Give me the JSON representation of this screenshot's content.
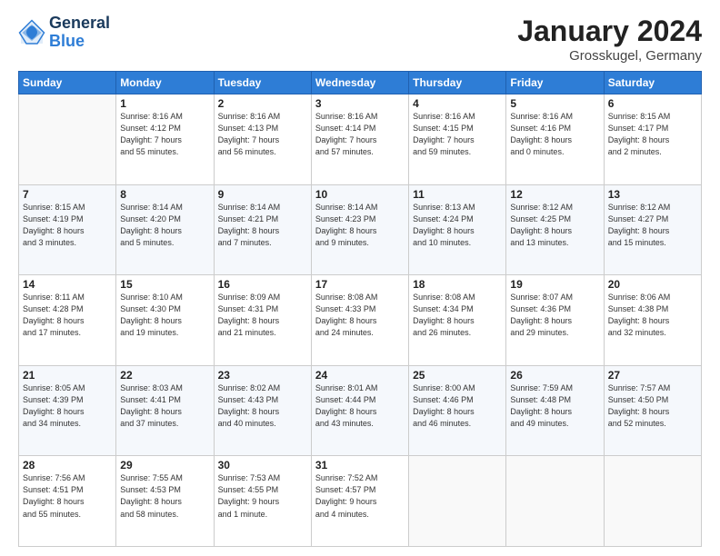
{
  "header": {
    "logo": {
      "line1": "General",
      "line2": "Blue"
    },
    "title": "January 2024",
    "subtitle": "Grosskugel, Germany"
  },
  "days_of_week": [
    "Sunday",
    "Monday",
    "Tuesday",
    "Wednesday",
    "Thursday",
    "Friday",
    "Saturday"
  ],
  "weeks": [
    [
      {
        "num": "",
        "sunrise": "",
        "sunset": "",
        "daylight": ""
      },
      {
        "num": "1",
        "sunrise": "Sunrise: 8:16 AM",
        "sunset": "Sunset: 4:12 PM",
        "daylight": "Daylight: 7 hours and 55 minutes."
      },
      {
        "num": "2",
        "sunrise": "Sunrise: 8:16 AM",
        "sunset": "Sunset: 4:13 PM",
        "daylight": "Daylight: 7 hours and 56 minutes."
      },
      {
        "num": "3",
        "sunrise": "Sunrise: 8:16 AM",
        "sunset": "Sunset: 4:14 PM",
        "daylight": "Daylight: 7 hours and 57 minutes."
      },
      {
        "num": "4",
        "sunrise": "Sunrise: 8:16 AM",
        "sunset": "Sunset: 4:15 PM",
        "daylight": "Daylight: 7 hours and 59 minutes."
      },
      {
        "num": "5",
        "sunrise": "Sunrise: 8:16 AM",
        "sunset": "Sunset: 4:16 PM",
        "daylight": "Daylight: 8 hours and 0 minutes."
      },
      {
        "num": "6",
        "sunrise": "Sunrise: 8:15 AM",
        "sunset": "Sunset: 4:17 PM",
        "daylight": "Daylight: 8 hours and 2 minutes."
      }
    ],
    [
      {
        "num": "7",
        "sunrise": "Sunrise: 8:15 AM",
        "sunset": "Sunset: 4:19 PM",
        "daylight": "Daylight: 8 hours and 3 minutes."
      },
      {
        "num": "8",
        "sunrise": "Sunrise: 8:14 AM",
        "sunset": "Sunset: 4:20 PM",
        "daylight": "Daylight: 8 hours and 5 minutes."
      },
      {
        "num": "9",
        "sunrise": "Sunrise: 8:14 AM",
        "sunset": "Sunset: 4:21 PM",
        "daylight": "Daylight: 8 hours and 7 minutes."
      },
      {
        "num": "10",
        "sunrise": "Sunrise: 8:14 AM",
        "sunset": "Sunset: 4:23 PM",
        "daylight": "Daylight: 8 hours and 9 minutes."
      },
      {
        "num": "11",
        "sunrise": "Sunrise: 8:13 AM",
        "sunset": "Sunset: 4:24 PM",
        "daylight": "Daylight: 8 hours and 10 minutes."
      },
      {
        "num": "12",
        "sunrise": "Sunrise: 8:12 AM",
        "sunset": "Sunset: 4:25 PM",
        "daylight": "Daylight: 8 hours and 13 minutes."
      },
      {
        "num": "13",
        "sunrise": "Sunrise: 8:12 AM",
        "sunset": "Sunset: 4:27 PM",
        "daylight": "Daylight: 8 hours and 15 minutes."
      }
    ],
    [
      {
        "num": "14",
        "sunrise": "Sunrise: 8:11 AM",
        "sunset": "Sunset: 4:28 PM",
        "daylight": "Daylight: 8 hours and 17 minutes."
      },
      {
        "num": "15",
        "sunrise": "Sunrise: 8:10 AM",
        "sunset": "Sunset: 4:30 PM",
        "daylight": "Daylight: 8 hours and 19 minutes."
      },
      {
        "num": "16",
        "sunrise": "Sunrise: 8:09 AM",
        "sunset": "Sunset: 4:31 PM",
        "daylight": "Daylight: 8 hours and 21 minutes."
      },
      {
        "num": "17",
        "sunrise": "Sunrise: 8:08 AM",
        "sunset": "Sunset: 4:33 PM",
        "daylight": "Daylight: 8 hours and 24 minutes."
      },
      {
        "num": "18",
        "sunrise": "Sunrise: 8:08 AM",
        "sunset": "Sunset: 4:34 PM",
        "daylight": "Daylight: 8 hours and 26 minutes."
      },
      {
        "num": "19",
        "sunrise": "Sunrise: 8:07 AM",
        "sunset": "Sunset: 4:36 PM",
        "daylight": "Daylight: 8 hours and 29 minutes."
      },
      {
        "num": "20",
        "sunrise": "Sunrise: 8:06 AM",
        "sunset": "Sunset: 4:38 PM",
        "daylight": "Daylight: 8 hours and 32 minutes."
      }
    ],
    [
      {
        "num": "21",
        "sunrise": "Sunrise: 8:05 AM",
        "sunset": "Sunset: 4:39 PM",
        "daylight": "Daylight: 8 hours and 34 minutes."
      },
      {
        "num": "22",
        "sunrise": "Sunrise: 8:03 AM",
        "sunset": "Sunset: 4:41 PM",
        "daylight": "Daylight: 8 hours and 37 minutes."
      },
      {
        "num": "23",
        "sunrise": "Sunrise: 8:02 AM",
        "sunset": "Sunset: 4:43 PM",
        "daylight": "Daylight: 8 hours and 40 minutes."
      },
      {
        "num": "24",
        "sunrise": "Sunrise: 8:01 AM",
        "sunset": "Sunset: 4:44 PM",
        "daylight": "Daylight: 8 hours and 43 minutes."
      },
      {
        "num": "25",
        "sunrise": "Sunrise: 8:00 AM",
        "sunset": "Sunset: 4:46 PM",
        "daylight": "Daylight: 8 hours and 46 minutes."
      },
      {
        "num": "26",
        "sunrise": "Sunrise: 7:59 AM",
        "sunset": "Sunset: 4:48 PM",
        "daylight": "Daylight: 8 hours and 49 minutes."
      },
      {
        "num": "27",
        "sunrise": "Sunrise: 7:57 AM",
        "sunset": "Sunset: 4:50 PM",
        "daylight": "Daylight: 8 hours and 52 minutes."
      }
    ],
    [
      {
        "num": "28",
        "sunrise": "Sunrise: 7:56 AM",
        "sunset": "Sunset: 4:51 PM",
        "daylight": "Daylight: 8 hours and 55 minutes."
      },
      {
        "num": "29",
        "sunrise": "Sunrise: 7:55 AM",
        "sunset": "Sunset: 4:53 PM",
        "daylight": "Daylight: 8 hours and 58 minutes."
      },
      {
        "num": "30",
        "sunrise": "Sunrise: 7:53 AM",
        "sunset": "Sunset: 4:55 PM",
        "daylight": "Daylight: 9 hours and 1 minute."
      },
      {
        "num": "31",
        "sunrise": "Sunrise: 7:52 AM",
        "sunset": "Sunset: 4:57 PM",
        "daylight": "Daylight: 9 hours and 4 minutes."
      },
      {
        "num": "",
        "sunrise": "",
        "sunset": "",
        "daylight": ""
      },
      {
        "num": "",
        "sunrise": "",
        "sunset": "",
        "daylight": ""
      },
      {
        "num": "",
        "sunrise": "",
        "sunset": "",
        "daylight": ""
      }
    ]
  ]
}
